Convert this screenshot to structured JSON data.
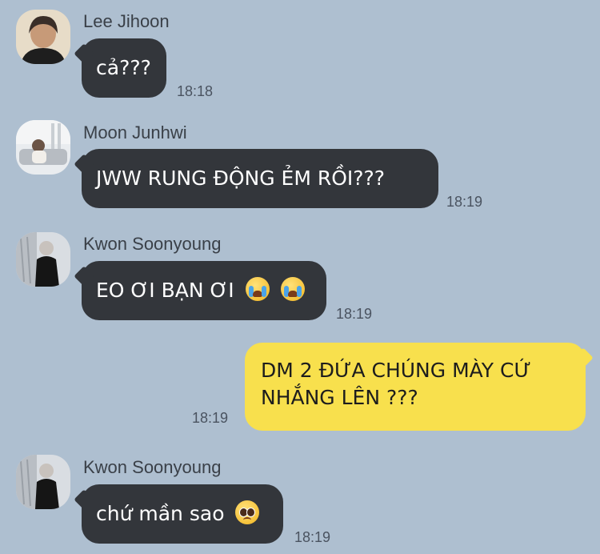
{
  "messages": [
    {
      "sender": "Lee Jihoon",
      "text": "cả???",
      "time": "18:18"
    },
    {
      "sender": "Moon Junhwi",
      "text": "JWW RUNG ĐỘNG ẺM RỒI???",
      "time": "18:19"
    },
    {
      "sender": "Kwon Soonyoung",
      "text": "EO ƠI BẠN ƠI",
      "emojis": [
        "loudly-crying-face-icon",
        "loudly-crying-face-icon"
      ],
      "time": "18:19"
    },
    {
      "sender": "me",
      "text_line1": "DM 2 ĐỨA CHÚNG MÀY CỨ",
      "text_line2": "NHẮNG LÊN ???",
      "time": "18:19"
    },
    {
      "sender": "Kwon Soonyoung",
      "text": "chứ mần sao",
      "emojis": [
        "pleading-face-icon"
      ],
      "time": "18:19"
    }
  ],
  "colors": {
    "background": "#aebfd0",
    "incoming_bubble": "#33363b",
    "outgoing_bubble": "#f8e04d"
  }
}
